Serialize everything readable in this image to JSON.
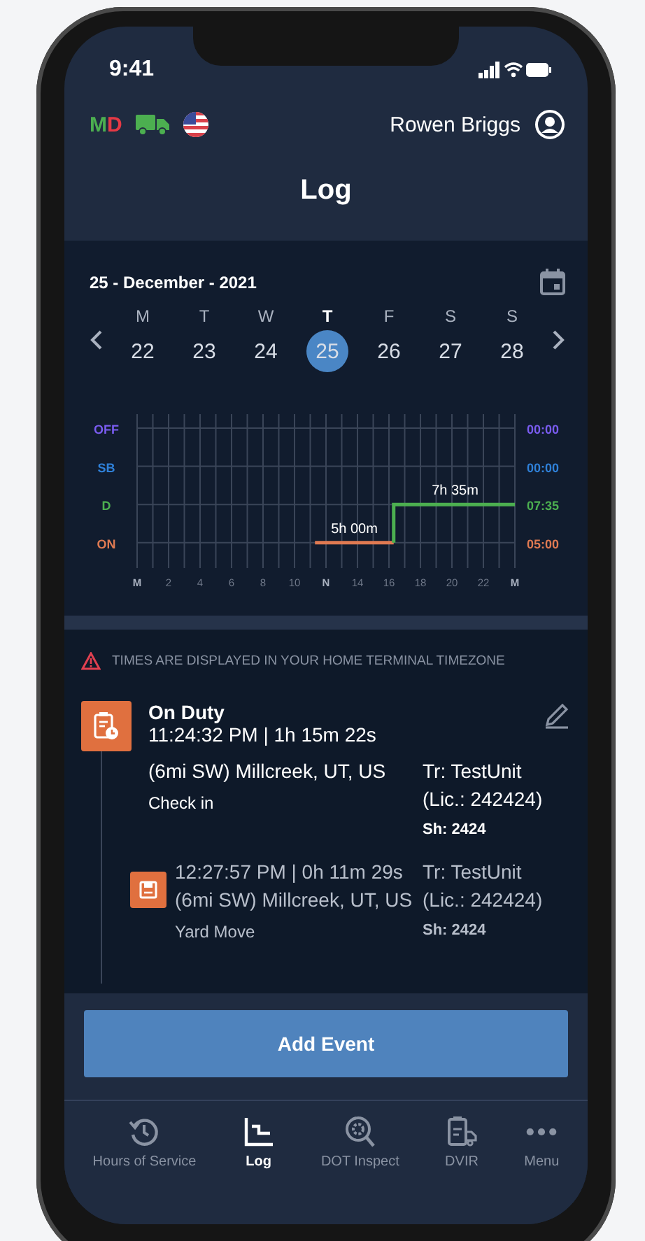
{
  "status_bar": {
    "time": "9:41"
  },
  "header": {
    "mode_letters": [
      {
        "text": "M",
        "color": "#4caf50"
      },
      {
        "text": "D",
        "color": "#e53945"
      }
    ],
    "user_name": "Rowen Briggs"
  },
  "title": "Log",
  "calendar": {
    "date_label": "25 - December - 2021",
    "days": [
      {
        "letter": "M",
        "date": "22",
        "selected": false
      },
      {
        "letter": "T",
        "date": "23",
        "selected": false
      },
      {
        "letter": "W",
        "date": "24",
        "selected": false
      },
      {
        "letter": "T",
        "date": "25",
        "selected": true
      },
      {
        "letter": "F",
        "date": "26",
        "selected": false
      },
      {
        "letter": "S",
        "date": "27",
        "selected": false
      },
      {
        "letter": "S",
        "date": "28",
        "selected": false
      }
    ]
  },
  "log_chart": {
    "statuses": [
      {
        "label": "OFF",
        "total": "00:00",
        "color": "#7a5cf0"
      },
      {
        "label": "SB",
        "total": "00:00",
        "color": "#2f80d8"
      },
      {
        "label": "D",
        "total": "07:35",
        "color": "#4caf50"
      },
      {
        "label": "ON",
        "total": "05:00",
        "color": "#e07a52"
      }
    ],
    "hour_labels": [
      "M",
      "2",
      "4",
      "6",
      "8",
      "10",
      "N",
      "14",
      "16",
      "18",
      "20",
      "22",
      "M"
    ],
    "durations": [
      "5h 00m",
      "7h 35m"
    ]
  },
  "notice": "TIMES ARE DISPLAYED IN YOUR HOME TERMINAL TIMEZONE",
  "events": [
    {
      "kind": "main",
      "title": "On Duty",
      "time": "11:24:32 PM | 1h 15m 22s",
      "location": "(6mi SW) Millcreek, UT, US",
      "note": "Check in",
      "unit": "Tr: TestUnit",
      "license": "(Lic.: 242424)",
      "shipping": "Sh: 2424"
    },
    {
      "kind": "sub",
      "time": "12:27:57 PM | 0h 11m 29s",
      "location": "(6mi SW) Millcreek, UT, US",
      "note": "Yard Move",
      "unit": "Tr: TestUnit",
      "license": "(Lic.: 242424)",
      "shipping": "Sh: 2424"
    }
  ],
  "add_button": "Add Event",
  "tabs": [
    {
      "label": "Hours of Service",
      "kind": "history",
      "selected": false
    },
    {
      "label": "Log",
      "kind": "log",
      "selected": true
    },
    {
      "label": "DOT Inspect",
      "kind": "inspect",
      "selected": false
    },
    {
      "label": "DVIR",
      "kind": "dvir",
      "selected": false
    },
    {
      "label": "Menu",
      "kind": "menu",
      "selected": false
    }
  ]
}
